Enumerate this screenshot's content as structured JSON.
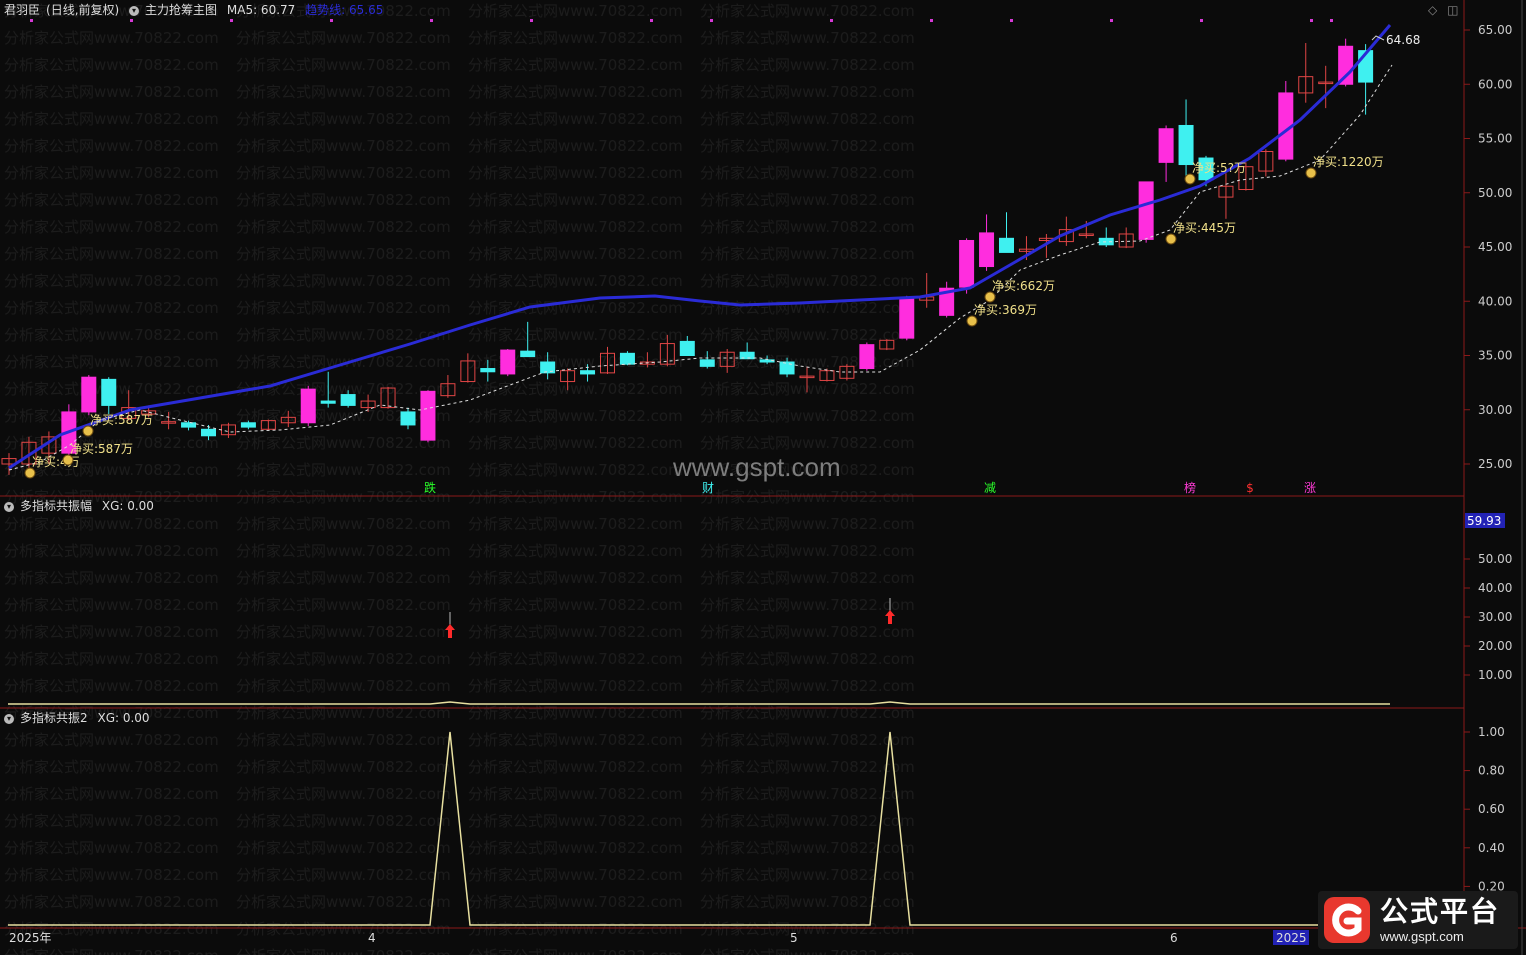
{
  "main_panel": {
    "stock_name": "君羽臣",
    "period": "(日线,前复权)",
    "indicator_name": "主力抢筹主图",
    "ma5_label": "MA5: 60.77",
    "trend_label": "趋势线: 65.65",
    "last_price_label": "64.68",
    "y_ticks": [
      "65.00",
      "60.00",
      "55.00",
      "50.00",
      "45.00",
      "40.00",
      "35.00",
      "30.00",
      "25.00"
    ],
    "y_tick_values": [
      65,
      60,
      55,
      50,
      45,
      40,
      35,
      30,
      25
    ],
    "net_buy_labels": [
      "净买:4万",
      "净买:587万",
      "净买:587万",
      "净买:369万",
      "净买:662万",
      "净买:445万",
      "净买:5?万",
      "净买:1220万"
    ],
    "event_marks": [
      "跌",
      "财",
      "减",
      "榜",
      "$",
      "涨"
    ]
  },
  "panel2": {
    "title": "多指标共振幅",
    "xg_label": "XG: 0.00",
    "current_value": "59.93",
    "y_ticks": [
      "50.00",
      "40.00",
      "30.00",
      "20.00",
      "10.00"
    ]
  },
  "panel3": {
    "title": "多指标共振2",
    "xg_label": "XG: 0.00",
    "y_ticks": [
      "1.00",
      "0.80",
      "0.60",
      "0.40",
      "0.20"
    ]
  },
  "x_axis": {
    "labels": [
      "2025年",
      "4",
      "5",
      "6",
      "2025"
    ]
  },
  "watermark": {
    "center": "www.gspt.com",
    "tile": "分析家公式网www.70822.com"
  },
  "brand": {
    "name": "公式平台",
    "url": "www.gspt.com"
  },
  "colors": {
    "up": "#ff2dde",
    "down": "#3ff0f0",
    "ma": "#2a2bd6",
    "hollow_up": "#e04545",
    "label": "#f0e08a",
    "axis": "#8b1a1a",
    "line": "#e8e0a0"
  }
}
